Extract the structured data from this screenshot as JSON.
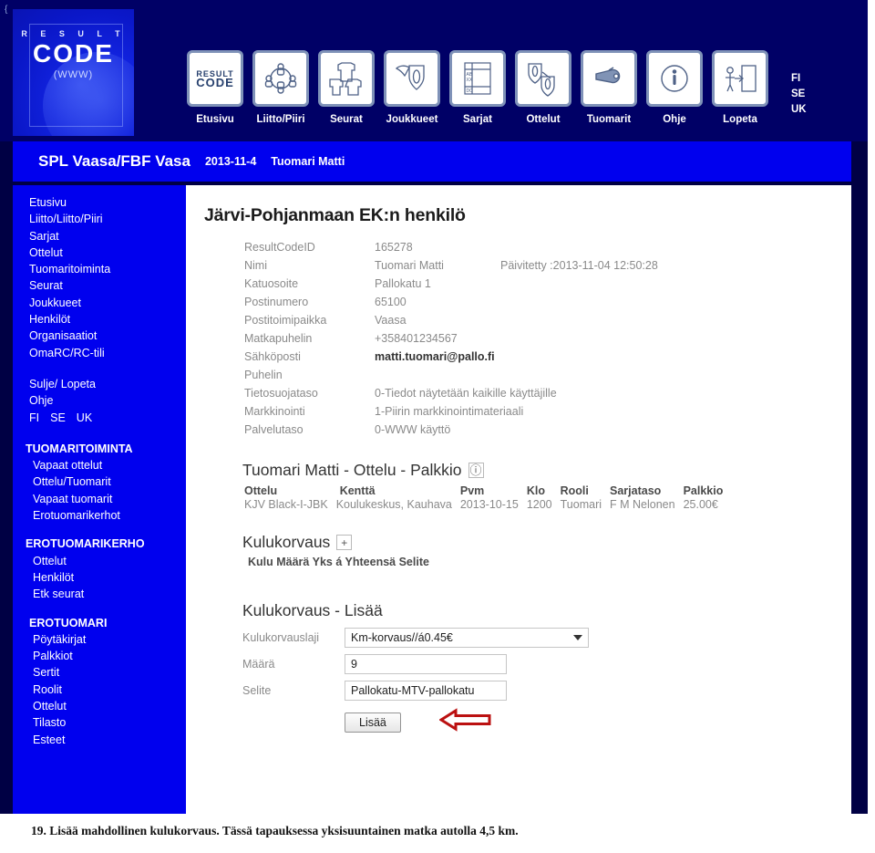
{
  "colors": {
    "navy": "#000066",
    "blue": "#0000ee",
    "accent_red": "#c00000",
    "text_gray": "#8a8a8a"
  },
  "logo": {
    "line1": "R E S U L T",
    "line2": "CODE",
    "line3": "(WWW)",
    "brace": "{"
  },
  "topnav": {
    "items": [
      {
        "label": "Etusivu",
        "icon": "resultcode-logo-icon"
      },
      {
        "label": "Liitto/Piiri",
        "icon": "people-circle-icon"
      },
      {
        "label": "Seurat",
        "icon": "shirts-icon"
      },
      {
        "label": "Joukkueet",
        "icon": "shield-flag-icon"
      },
      {
        "label": "Sarjat",
        "icon": "standings-table-icon"
      },
      {
        "label": "Ottelut",
        "icon": "two-shields-icon"
      },
      {
        "label": "Tuomarit",
        "icon": "whistle-icon"
      },
      {
        "label": "Ohje",
        "icon": "info-circle-icon"
      },
      {
        "label": "Lopeta",
        "icon": "exit-door-icon"
      }
    ],
    "languages": [
      "FI",
      "SE",
      "UK"
    ]
  },
  "titlebar": {
    "org": "SPL Vaasa/FBF Vasa",
    "date": "2013-11-4",
    "user": "Tuomari Matti"
  },
  "sidebar": {
    "main_links": [
      "Etusivu",
      "Liitto/Liitto/Piiri",
      "Sarjat",
      "Ottelut",
      "Tuomaritoiminta",
      "Seurat",
      "Joukkueet",
      "Henkilöt",
      "Organisaatiot",
      "OmaRC/RC-tili"
    ],
    "util_links": [
      "Sulje/ Lopeta",
      "Ohje"
    ],
    "languages": [
      "FI",
      "SE",
      "UK"
    ],
    "groups": [
      {
        "heading": "TUOMARITOIMINTA",
        "items": [
          "Vapaat ottelut",
          "Ottelu/Tuomarit",
          "Vapaat tuomarit",
          "Erotuomarikerhot"
        ]
      },
      {
        "heading": "EROTUOMARIKERHO",
        "items": [
          "Ottelut",
          "Henkilöt",
          "Etk seurat"
        ]
      },
      {
        "heading": "EROTUOMARI",
        "items": [
          "Pöytäkirjat",
          "Palkkiot",
          "Sertit",
          "Roolit",
          "Ottelut",
          "Tilasto",
          "Esteet"
        ]
      }
    ]
  },
  "main": {
    "page_title": "Järvi-Pohjanmaan EK:n henkilö",
    "details": [
      {
        "label": "ResultCodeID",
        "value": "165278",
        "extra": ""
      },
      {
        "label": "Nimi",
        "value": "Tuomari Matti",
        "extra": "Päivitetty :2013-11-04 12:50:28"
      },
      {
        "label": "Katuosoite",
        "value": "Pallokatu 1",
        "extra": ""
      },
      {
        "label": "Postinumero",
        "value": "65100",
        "extra": ""
      },
      {
        "label": "Postitoimipaikka",
        "value": "Vaasa",
        "extra": ""
      },
      {
        "label": "Matkapuhelin",
        "value": "+358401234567",
        "extra": ""
      },
      {
        "label": "Sähköposti",
        "value": "matti.tuomari@pallo.fi",
        "extra": "",
        "strong": true
      },
      {
        "label": "Puhelin",
        "value": "",
        "extra": ""
      },
      {
        "label": "Tietosuojataso",
        "value": "0-Tiedot näytetään kaikille käyttäjille",
        "extra": ""
      },
      {
        "label": "Markkinointi",
        "value": "1-Piirin markkinointimateriaali",
        "extra": ""
      },
      {
        "label": "Palvelutaso",
        "value": "0-WWW käyttö",
        "extra": ""
      }
    ],
    "match_section": {
      "title": "Tuomari Matti - Ottelu - Palkkio",
      "info_icon": "info-circle-icon",
      "columns": [
        "Ottelu",
        "Kenttä",
        "Pvm",
        "Klo",
        "Rooli",
        "Sarjataso",
        "Palkkio"
      ],
      "rows": [
        [
          "KJV Black-I-JBK",
          "Koulukeskus, Kauhava",
          "2013-10-15",
          "1200",
          "Tuomari",
          "F M Nelonen",
          "25.00€"
        ]
      ]
    },
    "expense_section": {
      "title": "Kulukorvaus",
      "add_icon": "plus-square-icon",
      "columns_text": "Kulu Määrä Yks á Yhteensä Selite"
    },
    "form": {
      "title": "Kulukorvaus - Lisää",
      "fields": [
        {
          "label": "Kulukorvauslaji",
          "type": "select",
          "value": "Km-korvaus//á0.45€"
        },
        {
          "label": "Määrä",
          "type": "text",
          "value": "9"
        },
        {
          "label": "Selite",
          "type": "text",
          "value": "Pallokatu-MTV-pallokatu"
        }
      ],
      "submit_label": "Lisää",
      "annotation_icon": "left-arrow-annotation"
    }
  },
  "caption": {
    "text": "19. Lisää mahdollinen kulukorvaus. Tässä tapauksessa yksisuuntainen matka autolla 4,5 km."
  }
}
